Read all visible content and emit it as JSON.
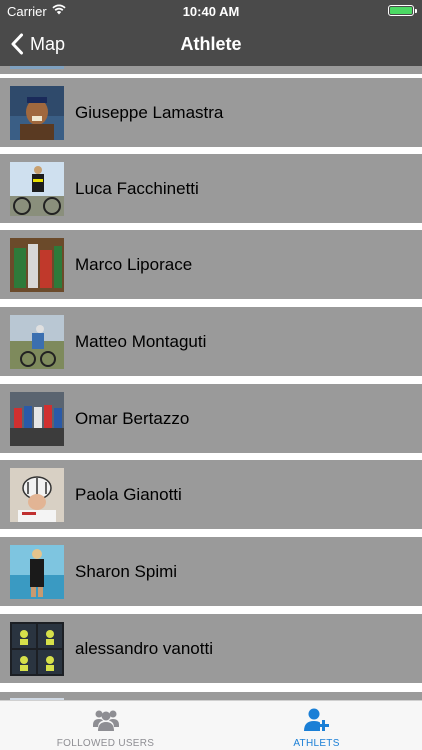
{
  "status_bar": {
    "carrier": "Carrier",
    "time": "10:40 AM",
    "battery_level": 1.0
  },
  "nav_bar": {
    "back_label": "Map",
    "back_icon": "chevron-left-icon",
    "title": "Athlete"
  },
  "athletes": [
    {
      "name": "Giuseppe Lamastra"
    },
    {
      "name": "Luca Facchinetti"
    },
    {
      "name": "Marco Liporace"
    },
    {
      "name": "Matteo Montaguti"
    },
    {
      "name": "Omar Bertazzo"
    },
    {
      "name": "Paola Gianotti"
    },
    {
      "name": "Sharon Spimi"
    },
    {
      "name": "alessandro vanotti"
    }
  ],
  "tab_bar": {
    "tabs": [
      {
        "label": "FOLLOWED USERS",
        "icon": "users-group-icon",
        "selected": false
      },
      {
        "label": "ATHLETS",
        "icon": "add-user-icon",
        "selected": true
      }
    ],
    "selected_color": "#1a7fd6",
    "unselected_color": "#8e8e93"
  },
  "colors": {
    "nav_background": "#4a4a4a",
    "row_background": "#9a9a9a",
    "separator": "#ffffff"
  }
}
